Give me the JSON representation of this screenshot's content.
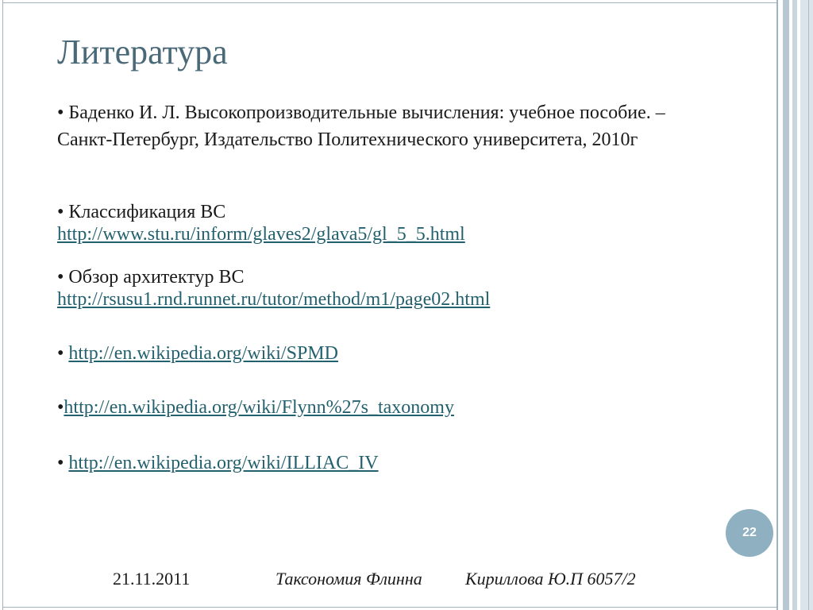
{
  "slide": {
    "title": "Литература",
    "entries": [
      {
        "bullet": "•",
        "text": " Баденко И. Л. Высокопроизводительные вычисления: учебное пособие. – Санкт-Петербург, Издательство Политехнического университета, 2010г"
      },
      {
        "bullet": "•",
        "text": " Классификация ВС",
        "link": "http://www.stu.ru/inform/glaves2/glava5/gl_5_5.html"
      },
      {
        "bullet": "•",
        "text": " Обзор архитектур ВС",
        "link": "http://rsusu1.rnd.runnet.ru/tutor/method/m1/page02.html"
      },
      {
        "bullet": "• ",
        "link": "http://en.wikipedia.org/wiki/SPMD"
      },
      {
        "bullet": "•",
        "link": "http://en.wikipedia.org/wiki/Flynn%27s_taxonomy"
      },
      {
        "bullet": "• ",
        "link": "http://en.wikipedia.org/wiki/ILLIAC_IV"
      }
    ],
    "page_number": "22"
  },
  "footer": {
    "date": "21.11.2011",
    "topic": "Таксономия Флинна",
    "author": "Кириллова Ю.П 6057/2"
  },
  "colors": {
    "title": "#4a6978",
    "link": "#24616e",
    "page_badge": "#8fb0c1",
    "frame": "#9fb4c0"
  }
}
